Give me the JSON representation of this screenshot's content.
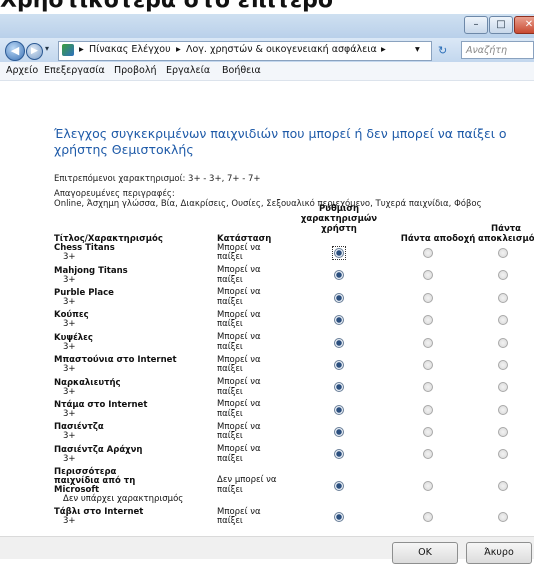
{
  "caption": "Χρηστικότερα στο επίτερο",
  "window": {
    "minimize": "–",
    "maximize": "□",
    "close": "✕"
  },
  "address": {
    "back_icon": "back-arrow-icon",
    "forward_icon": "forward-arrow-icon",
    "crumbs": [
      "Πίνακας Ελέγχου",
      "Λογ. χρηστών & οικογενειακή ασφάλεια"
    ],
    "search_placeholder": "Αναζήτη"
  },
  "menu": [
    "Αρχείο",
    "Επεξεργασία",
    "Προβολή",
    "Εργαλεία",
    "Βοήθεια"
  ],
  "heading": "Έλεγχος συγκεκριμένων παιχνιδιών που μπορεί ή δεν μπορεί να παίξει ο χρήστης Θεμιστοκλής",
  "allowed_ratings": "Επιτρεπόμενοι χαρακτηρισμοί: 3+ - 3+, 7+ - 7+",
  "blocked_label": "Απαγορευμένες περιγραφές:",
  "blocked_list": "Online, Άσχημη γλώσσα, Βία, Διακρίσεις, Ουσίες, Σεξουαλικό περιεχόμενο, Τυχερά παιχνίδια, Φόβος",
  "columns": {
    "title": "Τίτλος/Χαρακτηρισμός",
    "status": "Κατάσταση",
    "user_setting_1": "Ρύθμιση",
    "user_setting_2": "χαρακτηρισμών",
    "user_setting_3": "χρήστη",
    "always_allow": "Πάντα αποδοχή",
    "always_block_1": "Πάντα",
    "always_block_2": "αποκλεισμός"
  },
  "games": [
    {
      "title": "Chess Titans",
      "rating": "3+",
      "status": "Μπορεί να παίξει",
      "selected": "user"
    },
    {
      "title": "Mahjong Titans",
      "rating": "3+",
      "status": "Μπορεί να παίξει",
      "selected": "user"
    },
    {
      "title": "Purble Place",
      "rating": "3+",
      "status": "Μπορεί να παίξει",
      "selected": "user"
    },
    {
      "title": "Κούπες",
      "rating": "3+",
      "status": "Μπορεί να παίξει",
      "selected": "user"
    },
    {
      "title": "Κυψέλες",
      "rating": "3+",
      "status": "Μπορεί να παίξει",
      "selected": "user"
    },
    {
      "title": "Μπαστούνια στο Internet",
      "rating": "3+",
      "status": "Μπορεί να παίξει",
      "selected": "user"
    },
    {
      "title": "Ναρκαλιευτής",
      "rating": "3+",
      "status": "Μπορεί να παίξει",
      "selected": "user"
    },
    {
      "title": "Ντάμα στο Internet",
      "rating": "3+",
      "status": "Μπορεί να παίξει",
      "selected": "user"
    },
    {
      "title": "Πασιέντζα",
      "rating": "3+",
      "status": "Μπορεί να παίξει",
      "selected": "user"
    },
    {
      "title": "Πασιέντζα Αράχνη",
      "rating": "3+",
      "status": "Μπορεί να παίξει",
      "selected": "user"
    },
    {
      "title": "Περισσότερα παιχνίδια από τη Microsoft",
      "rating": "Δεν υπάρχει χαρακτηρισμός",
      "status": "Δεν μπορεί να παίξει",
      "selected": "user"
    },
    {
      "title": "Τάβλι στο Internet",
      "rating": "3+",
      "status": "Μπορεί να παίξει",
      "selected": "user"
    }
  ],
  "buttons": {
    "ok": "OK",
    "cancel": "Άκυρο"
  }
}
